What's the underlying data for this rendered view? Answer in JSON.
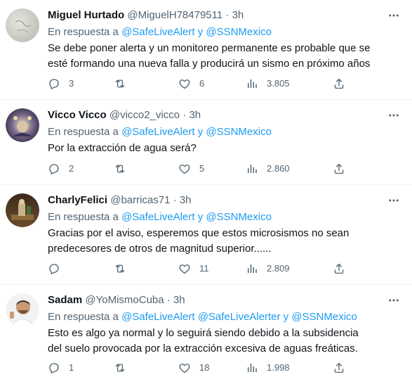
{
  "tweets": [
    {
      "name": "Miguel Hurtado",
      "handle": "@MiguelH78479511",
      "sep": "·",
      "time": "3h",
      "reply_prefix": "En respuesta a",
      "reply_mentions": "@SafeLiveAlert y @SSNMexico",
      "text": "Se debe poner alerta y un monitoreo permanente es probable que se esté formando una nueva falla y producirá un sismo en próximo años",
      "replies": "3",
      "retweets": "",
      "likes": "6",
      "views": "3.805"
    },
    {
      "name": "Vicco Vicco",
      "handle": "@vicco2_vicco",
      "sep": "·",
      "time": "3h",
      "reply_prefix": "En respuesta a",
      "reply_mentions": "@SafeLiveAlert y @SSNMexico",
      "text": "Por la extracción de agua será?",
      "replies": "2",
      "retweets": "",
      "likes": "5",
      "views": "2.860"
    },
    {
      "name": "CharlyFelici",
      "handle": "@barricas71",
      "sep": "·",
      "time": "3h",
      "reply_prefix": "En respuesta a",
      "reply_mentions": "@SafeLiveAlert y @SSNMexico",
      "text": "Gracias por el aviso, esperemos que estos microsismos no sean predecesores de otros de magnitud superior......",
      "replies": "",
      "retweets": "",
      "likes": "11",
      "views": "2.809"
    },
    {
      "name": "Sadam",
      "handle": "@YoMismoCuba",
      "sep": "·",
      "time": "3h",
      "reply_prefix": "En respuesta a",
      "reply_mentions": "@SafeLiveAlert @SafeLiveAlerter y @SSNMexico",
      "text": "Esto es algo ya normal y lo seguirá siendo debido a la subsidencia del suelo provocada por la extracción excesiva de aguas freáticas.",
      "replies": "1",
      "retweets": "",
      "likes": "18",
      "views": "1.998"
    }
  ],
  "icons": {
    "more": "more-dots-icon",
    "reply": "reply-bubble-icon",
    "retweet": "retweet-icon",
    "like": "heart-icon",
    "views": "views-bar-chart-icon",
    "share": "share-upload-icon"
  },
  "colors": {
    "text": "#0f1419",
    "secondary": "#536471",
    "link": "#1d9bf0",
    "divider": "#eff3f4"
  }
}
